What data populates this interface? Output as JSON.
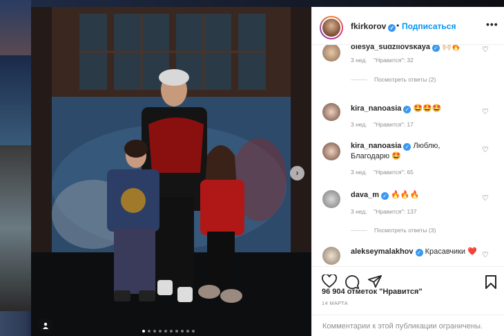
{
  "post": {
    "username": "fkirkorov",
    "follow_label": "Подписаться",
    "dot": "•",
    "more_glyph": "•••"
  },
  "comments": [
    {
      "user": "olesya_sudzilovskaya",
      "text": "🙌🏻🔥",
      "time": "3 нед.",
      "likes": "\"Нравится\": 32",
      "replies": "Посмотреть ответы (2)"
    },
    {
      "user": "kira_nanoasia",
      "text": "🤩🤩🤩",
      "time": "3 нед.",
      "likes": "\"Нравится\": 17"
    },
    {
      "user": "kira_nanoasia",
      "text": "Люблю, Благодарю 🤩",
      "time": "3 нед.",
      "likes": "\"Нравится\": 65"
    },
    {
      "user": "dava_m",
      "text": "🔥🔥🔥",
      "time": "3 нед.",
      "likes": "\"Нравится\": 137",
      "replies": "Посмотреть ответы (3)"
    },
    {
      "user": "alekseymalakhov",
      "text": "Красавчики ❤️"
    }
  ],
  "likes_text": "96 904 отметок \"Нравится\"",
  "date_text": "14 МАРТА",
  "comments_limited": "Комментарии к этой публикации ограничены.",
  "icons": {
    "verified": "✓",
    "heart": "♡",
    "next": "›",
    "tag": "👤"
  },
  "colors": {
    "follow": "#0095f6",
    "verified": "#3897f0",
    "muted": "#8e8e8e"
  },
  "carousel": {
    "total": 10,
    "active": 1
  }
}
